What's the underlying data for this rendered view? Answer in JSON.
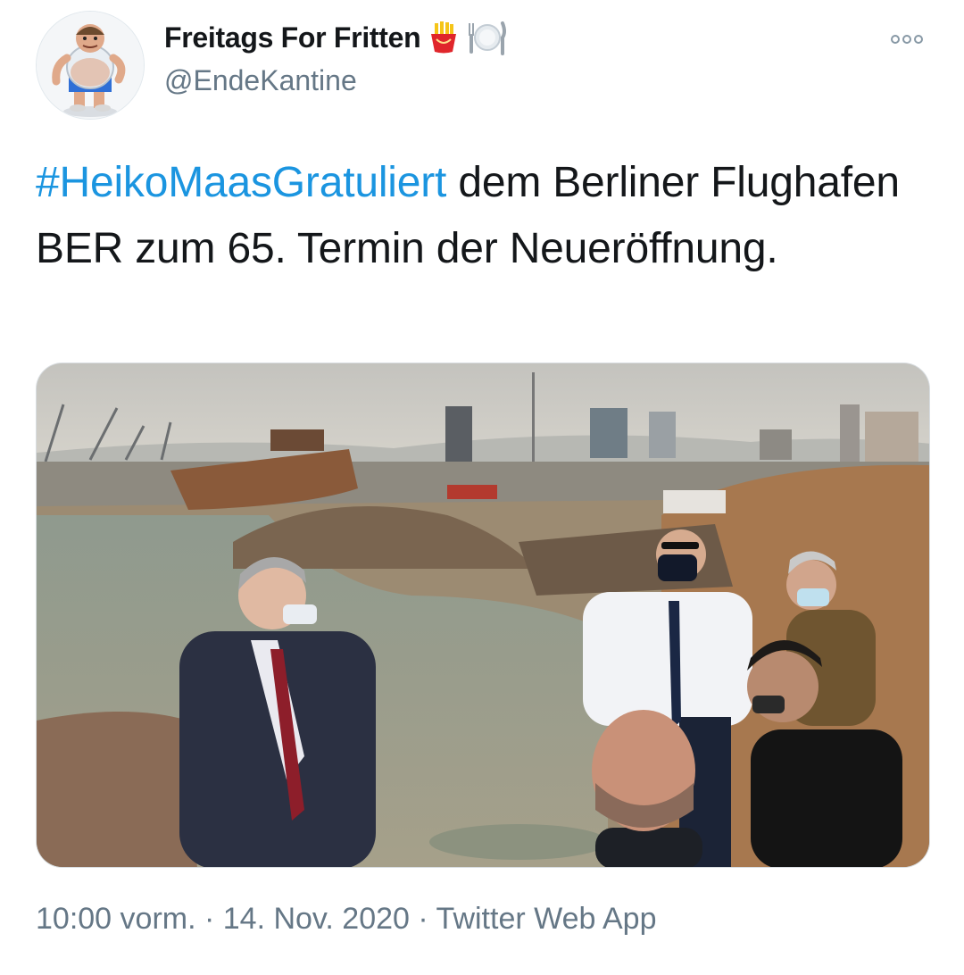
{
  "author": {
    "display_name": "Freitags For Fritten",
    "handle": "@EndeKantine",
    "emoji_icons": [
      "fries-icon",
      "plate-cutlery-icon"
    ]
  },
  "tweet": {
    "hashtag": "#HeikoMaasGratuliert",
    "text": " dem Berliner Flughafen BER zum 65. Termin der Neueröffnung."
  },
  "meta": {
    "time": "10:00 vorm.",
    "sep1": " · ",
    "date": "14. Nov. 2020",
    "sep2": " · ",
    "source": "Twitter Web App"
  },
  "colors": {
    "hashtag": "#1b95e0",
    "meta_text": "#657786"
  }
}
